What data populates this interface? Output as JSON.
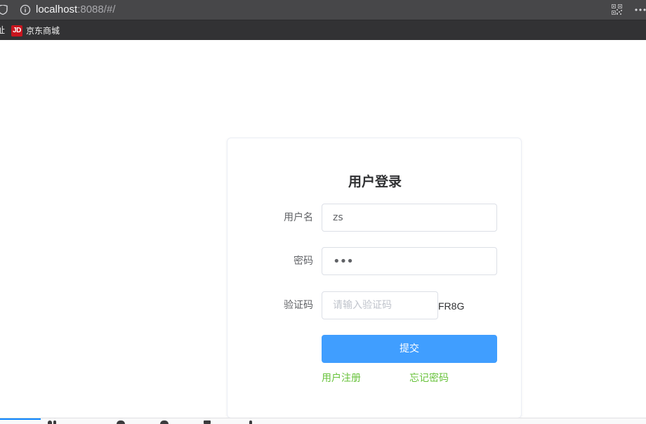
{
  "browser": {
    "url_host": "localhost",
    "url_rest": ":8088/#/",
    "icons": {
      "shield": "shield-icon",
      "info": "info-icon",
      "qr": "qr-code-icon",
      "more": "more-icon"
    }
  },
  "bookmarks": {
    "partial_label": "址",
    "items": [
      {
        "logo_text": "JD",
        "label": "京东商城",
        "logo_color": "#c9151e"
      }
    ]
  },
  "login": {
    "title": "用户登录",
    "username": {
      "label": "用户名",
      "value": "zs"
    },
    "password": {
      "label": "密码",
      "value": "•••"
    },
    "captcha": {
      "label": "验证码",
      "placeholder": "请输入验证码",
      "code": "FR8G"
    },
    "submit_label": "提交",
    "register_link": "用户注册",
    "forgot_link": "忘记密码"
  },
  "colors": {
    "primary": "#409eff",
    "link": "#67c23a",
    "chrome_dark": "#474749",
    "bookmarks_bg": "#323234"
  }
}
